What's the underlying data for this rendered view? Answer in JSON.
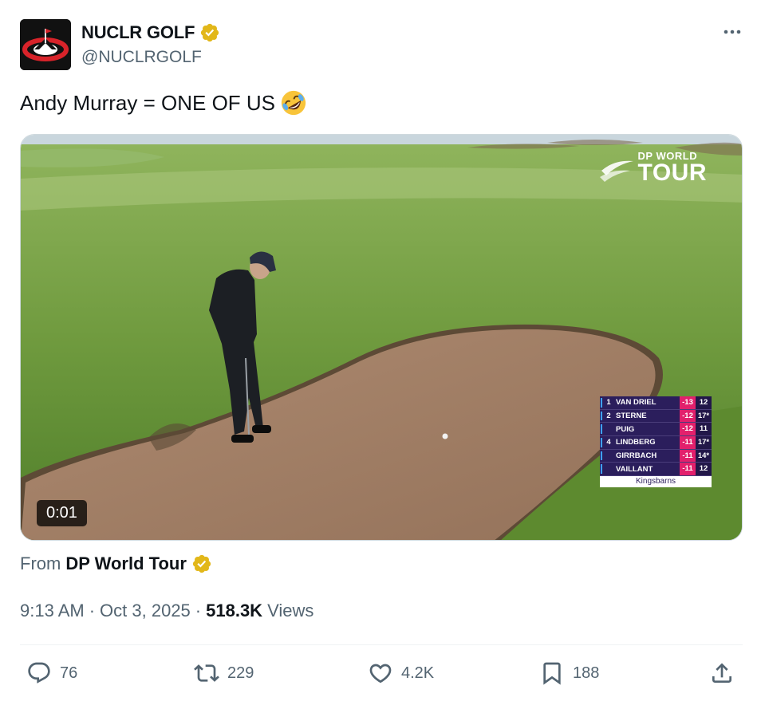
{
  "author": {
    "name": "NUCLR GOLF",
    "handle": "@NUCLRGOLF",
    "verified_color": "#e2b719"
  },
  "tweet": {
    "text": "Andy Murray = ONE OF US",
    "emoji": "rolling-on-floor-laughing"
  },
  "media": {
    "timestamp": "0:01",
    "logo": {
      "top": "DP WORLD",
      "bottom": "TOUR"
    },
    "leaderboard": {
      "rows": [
        {
          "pos": "1",
          "name": "VAN DRIEL",
          "score": "-13",
          "thru": "12"
        },
        {
          "pos": "2",
          "name": "STERNE",
          "score": "-12",
          "thru": "17*"
        },
        {
          "pos": "",
          "name": "PUIG",
          "score": "-12",
          "thru": "11"
        },
        {
          "pos": "4",
          "name": "LINDBERG",
          "score": "-11",
          "thru": "17*"
        },
        {
          "pos": "",
          "name": "GIRRBACH",
          "score": "-11",
          "thru": "14*"
        },
        {
          "pos": "",
          "name": "VAILLANT",
          "score": "-11",
          "thru": "12"
        }
      ],
      "footer": "Kingsbarns"
    }
  },
  "source": {
    "prefix": "From",
    "name": "DP World Tour"
  },
  "meta": {
    "time": "9:13 AM",
    "date": "Oct 3, 2025",
    "views_count": "518.3K",
    "views_label": "Views"
  },
  "actions": {
    "replies": "76",
    "reposts": "229",
    "likes": "4.2K",
    "bookmarks": "188"
  },
  "colors": {
    "text_primary": "#0f1419",
    "text_secondary": "#536471",
    "leaderboard_bg": "#2b1e5c",
    "leaderboard_score": "#e2206c"
  }
}
